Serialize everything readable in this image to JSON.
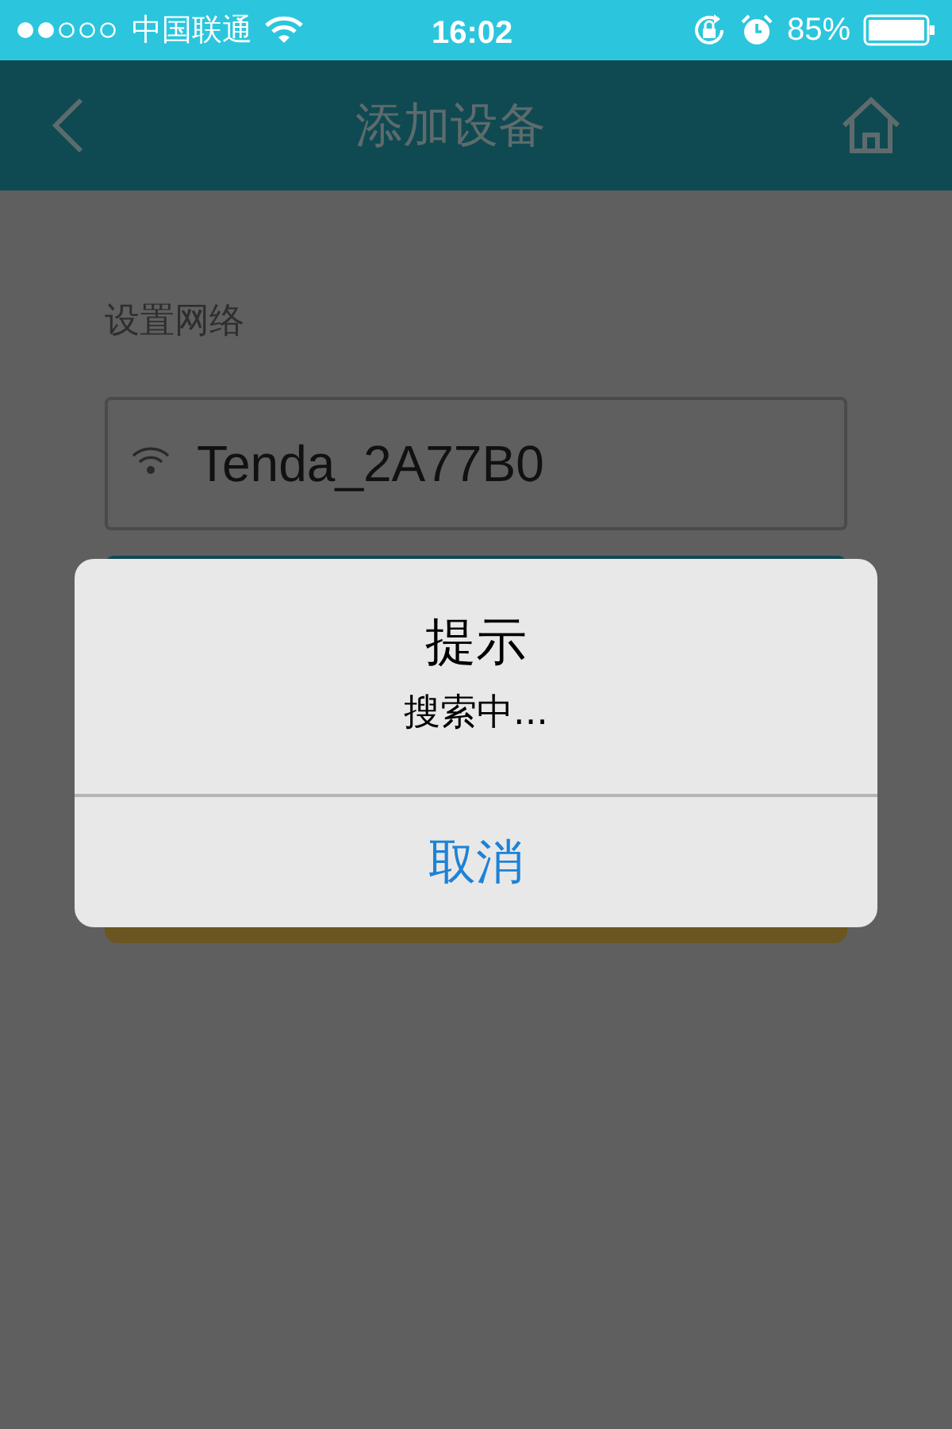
{
  "status_bar": {
    "carrier": "中国联通",
    "time": "16:02",
    "battery": "85%"
  },
  "nav_bar": {
    "title": "添加设备"
  },
  "form": {
    "section_label": "设置网络",
    "network_field": {
      "value": "Tenda_2A77B0"
    }
  },
  "alert": {
    "title": "提示",
    "message": "搜索中...",
    "buttons": [
      "取消"
    ]
  }
}
